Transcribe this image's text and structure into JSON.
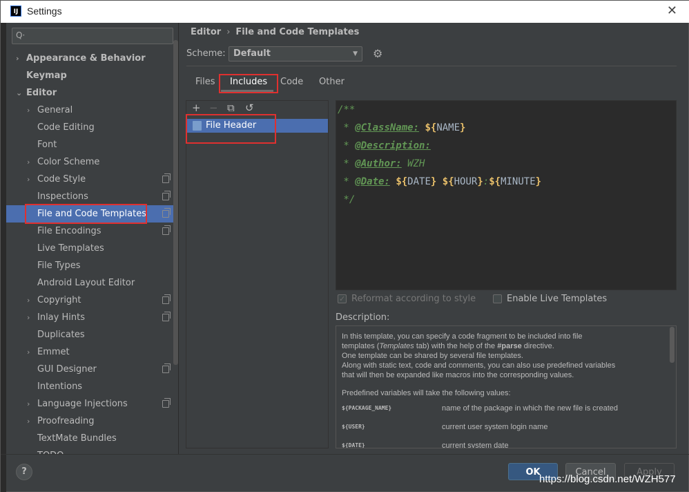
{
  "window": {
    "title": "Settings",
    "app_icon": "IJ"
  },
  "sidebar": {
    "search_placeholder": "Q·",
    "items": [
      {
        "label": "Appearance & Behavior",
        "level": 0,
        "expandable": true,
        "expanded": false,
        "bold": true
      },
      {
        "label": "Keymap",
        "level": 0,
        "expandable": false,
        "bold": true
      },
      {
        "label": "Editor",
        "level": 0,
        "expandable": true,
        "expanded": true,
        "bold": true
      },
      {
        "label": "General",
        "level": 1,
        "expandable": true
      },
      {
        "label": "Code Editing",
        "level": 1
      },
      {
        "label": "Font",
        "level": 1
      },
      {
        "label": "Color Scheme",
        "level": 1,
        "expandable": true
      },
      {
        "label": "Code Style",
        "level": 1,
        "expandable": true,
        "project_icon": true
      },
      {
        "label": "Inspections",
        "level": 1,
        "project_icon": true
      },
      {
        "label": "File and Code Templates",
        "level": 1,
        "project_icon": true,
        "selected": true
      },
      {
        "label": "File Encodings",
        "level": 1,
        "project_icon": true
      },
      {
        "label": "Live Templates",
        "level": 1
      },
      {
        "label": "File Types",
        "level": 1
      },
      {
        "label": "Android Layout Editor",
        "level": 1
      },
      {
        "label": "Copyright",
        "level": 1,
        "expandable": true,
        "project_icon": true
      },
      {
        "label": "Inlay Hints",
        "level": 1,
        "expandable": true,
        "project_icon": true
      },
      {
        "label": "Duplicates",
        "level": 1
      },
      {
        "label": "Emmet",
        "level": 1,
        "expandable": true
      },
      {
        "label": "GUI Designer",
        "level": 1,
        "project_icon": true
      },
      {
        "label": "Intentions",
        "level": 1
      },
      {
        "label": "Language Injections",
        "level": 1,
        "expandable": true,
        "project_icon": true
      },
      {
        "label": "Proofreading",
        "level": 1,
        "expandable": true
      },
      {
        "label": "TextMate Bundles",
        "level": 1
      },
      {
        "label": "TODO",
        "level": 1
      }
    ]
  },
  "breadcrumb": {
    "parent": "Editor",
    "separator": "›",
    "current": "File and Code Templates"
  },
  "scheme": {
    "label": "Scheme:",
    "value": "Default"
  },
  "tabs": [
    {
      "label": "Files"
    },
    {
      "label": "Includes",
      "selected": true
    },
    {
      "label": "Code"
    },
    {
      "label": "Other"
    }
  ],
  "toolbar": {
    "add": "+",
    "remove": "−",
    "copy": "⧉",
    "reset": "↺"
  },
  "templates": [
    {
      "label": "File Header",
      "selected": true
    }
  ],
  "editor": {
    "lines": [
      {
        "parts": [
          {
            "cls": "c-grey",
            "text": "/**"
          }
        ]
      },
      {
        "parts": [
          {
            "cls": "c-grey",
            "text": " * "
          },
          {
            "cls": "c-tag",
            "text": "@ClassName:"
          },
          {
            "cls": "c-plain",
            "text": " "
          },
          {
            "cls": "c-var",
            "text": "${"
          },
          {
            "cls": "c-plain",
            "text": "NAME"
          },
          {
            "cls": "c-var",
            "text": "}"
          }
        ]
      },
      {
        "parts": [
          {
            "cls": "c-grey",
            "text": " * "
          },
          {
            "cls": "c-tag",
            "text": "@Description:"
          }
        ]
      },
      {
        "parts": [
          {
            "cls": "c-grey",
            "text": " * "
          },
          {
            "cls": "c-tag",
            "text": "@Author:"
          },
          {
            "cls": "c-name",
            "text": " WZH"
          }
        ]
      },
      {
        "parts": [
          {
            "cls": "c-grey",
            "text": " * "
          },
          {
            "cls": "c-tag",
            "text": "@Date:"
          },
          {
            "cls": "c-plain",
            "text": " "
          },
          {
            "cls": "c-var",
            "text": "${"
          },
          {
            "cls": "c-plain",
            "text": "DATE"
          },
          {
            "cls": "c-var",
            "text": "}"
          },
          {
            "cls": "c-plain",
            "text": " "
          },
          {
            "cls": "c-var",
            "text": "${"
          },
          {
            "cls": "c-plain",
            "text": "HOUR"
          },
          {
            "cls": "c-var",
            "text": "}"
          },
          {
            "cls": "c-grey",
            "text": ":"
          },
          {
            "cls": "c-var",
            "text": "${"
          },
          {
            "cls": "c-plain",
            "text": "MINUTE"
          },
          {
            "cls": "c-var",
            "text": "}"
          }
        ]
      },
      {
        "parts": [
          {
            "cls": "c-grey",
            "text": " */"
          }
        ]
      }
    ]
  },
  "options": {
    "reformat": {
      "label": "Reformat according to style",
      "checked": true,
      "disabled": true
    },
    "live_templates": {
      "label": "Enable Live Templates",
      "checked": false
    }
  },
  "description": {
    "label": "Description:",
    "p1_a": "In this template, you can specify a code fragment to be included into file",
    "p1_b1": "templates (",
    "p1_b_em": "Templates",
    "p1_b2": " tab) with the help of the ",
    "p1_b_strong": "#parse",
    "p1_b3": " directive.",
    "p1_c": "One template can be shared by several file templates.",
    "p1_d": "Along with static text, code and comments, you can also use predefined variables",
    "p1_e": "that will then be expanded like macros into the corresponding values.",
    "p2": "Predefined variables will take the following values:",
    "vars": [
      {
        "name": "${PACKAGE_NAME}",
        "desc": "name of the package in which the new file is created"
      },
      {
        "name": "${USER}",
        "desc": "current user system login name"
      },
      {
        "name": "${DATE}",
        "desc": "current system date"
      }
    ]
  },
  "footer": {
    "help": "?",
    "ok": "OK",
    "cancel": "Cancel",
    "apply": "Apply"
  },
  "watermark": "https://blog.csdn.net/WZH577",
  "colors": {
    "selection": "#4b6eaf",
    "highlight_box": "#e0302f",
    "ok_button": "#365880"
  }
}
